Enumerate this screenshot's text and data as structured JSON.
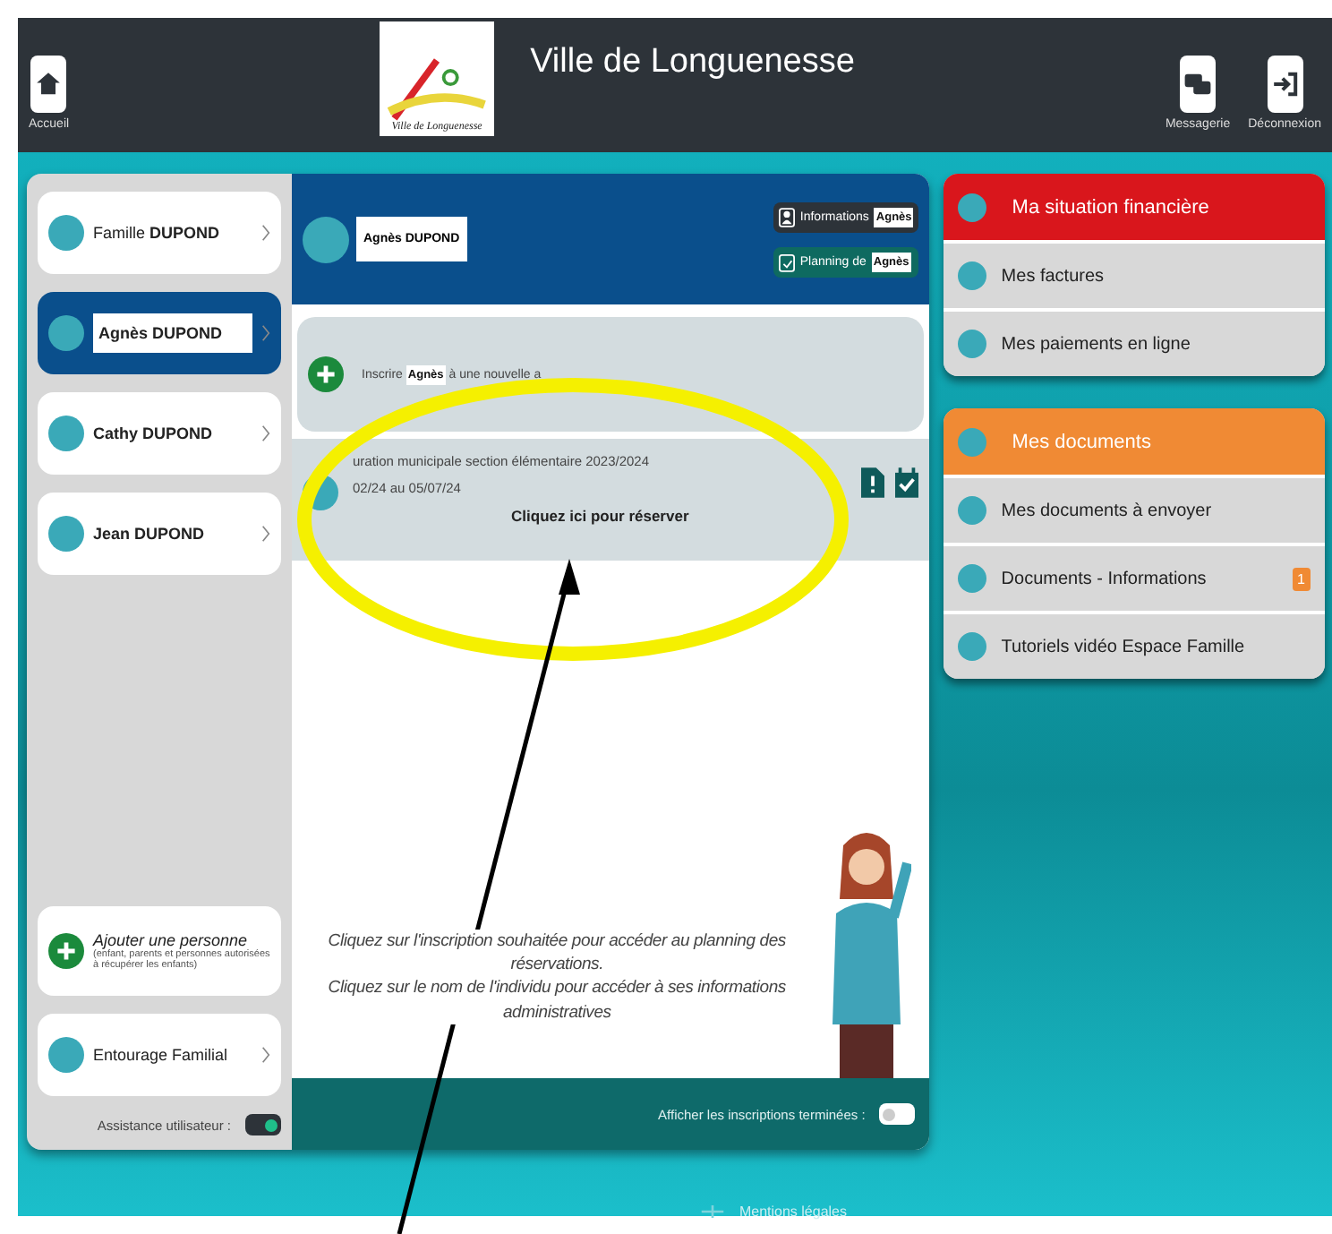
{
  "header": {
    "home_label": "Accueil",
    "logo_text": "Ville de Longuenesse",
    "title": "Ville de Longuenesse",
    "actions": [
      {
        "kind": "messages",
        "label": "Messagerie"
      },
      {
        "kind": "logout",
        "label": "Déconnexion"
      }
    ]
  },
  "sidebar": {
    "people": [
      {
        "name_prefix": "Famille",
        "name": "DUPOND",
        "selected": false
      },
      {
        "name": "Agnès DUPOND",
        "selected": true
      },
      {
        "name": "Cathy DUPOND",
        "selected": false
      },
      {
        "name": "Jean DUPOND",
        "selected": false
      }
    ],
    "add_person": {
      "title": "Ajouter une personne",
      "subtitle": "(enfant, parents et personnes autorisées à récupérer les enfants)"
    },
    "entourage": "Entourage Familial",
    "assistance": {
      "label": "Assistance utilisateur :",
      "on": true
    }
  },
  "person": {
    "name": "Agnès DUPOND",
    "info_button": {
      "label": "Informations",
      "name": "Agnès"
    },
    "planning_button": {
      "label": "Planning de",
      "name": "Agnès"
    }
  },
  "enroll": {
    "prefix": "Inscrire",
    "name": "Agnès",
    "suffix": "à une nouvelle a"
  },
  "registration": {
    "title": "uration municipale section élémentaire 2023/2024",
    "dates": "02/24 au 05/07/24",
    "action": "Cliquez ici pour réserver"
  },
  "help_text": {
    "line1": "Cliquez sur l'inscription souhaitée pour accéder au planning des réservations.",
    "line2": "Cliquez sur le nom de l'individu pour accéder à ses informations administratives"
  },
  "show_finished": {
    "label": "Afficher les inscriptions terminées :",
    "on": false
  },
  "panels": [
    {
      "title": "Ma situation financière",
      "color": "#d9161c",
      "items": [
        {
          "label": "Mes factures"
        },
        {
          "label": "Mes paiements en ligne"
        }
      ]
    },
    {
      "title": "Mes documents",
      "color": "#f08a34",
      "items": [
        {
          "label": "Mes documents à envoyer"
        },
        {
          "label": "Documents - Informations",
          "badge": "1"
        },
        {
          "label": "Tutoriels vidéo Espace Famille"
        }
      ]
    }
  ],
  "footer": {
    "link": "Mentions légales"
  }
}
